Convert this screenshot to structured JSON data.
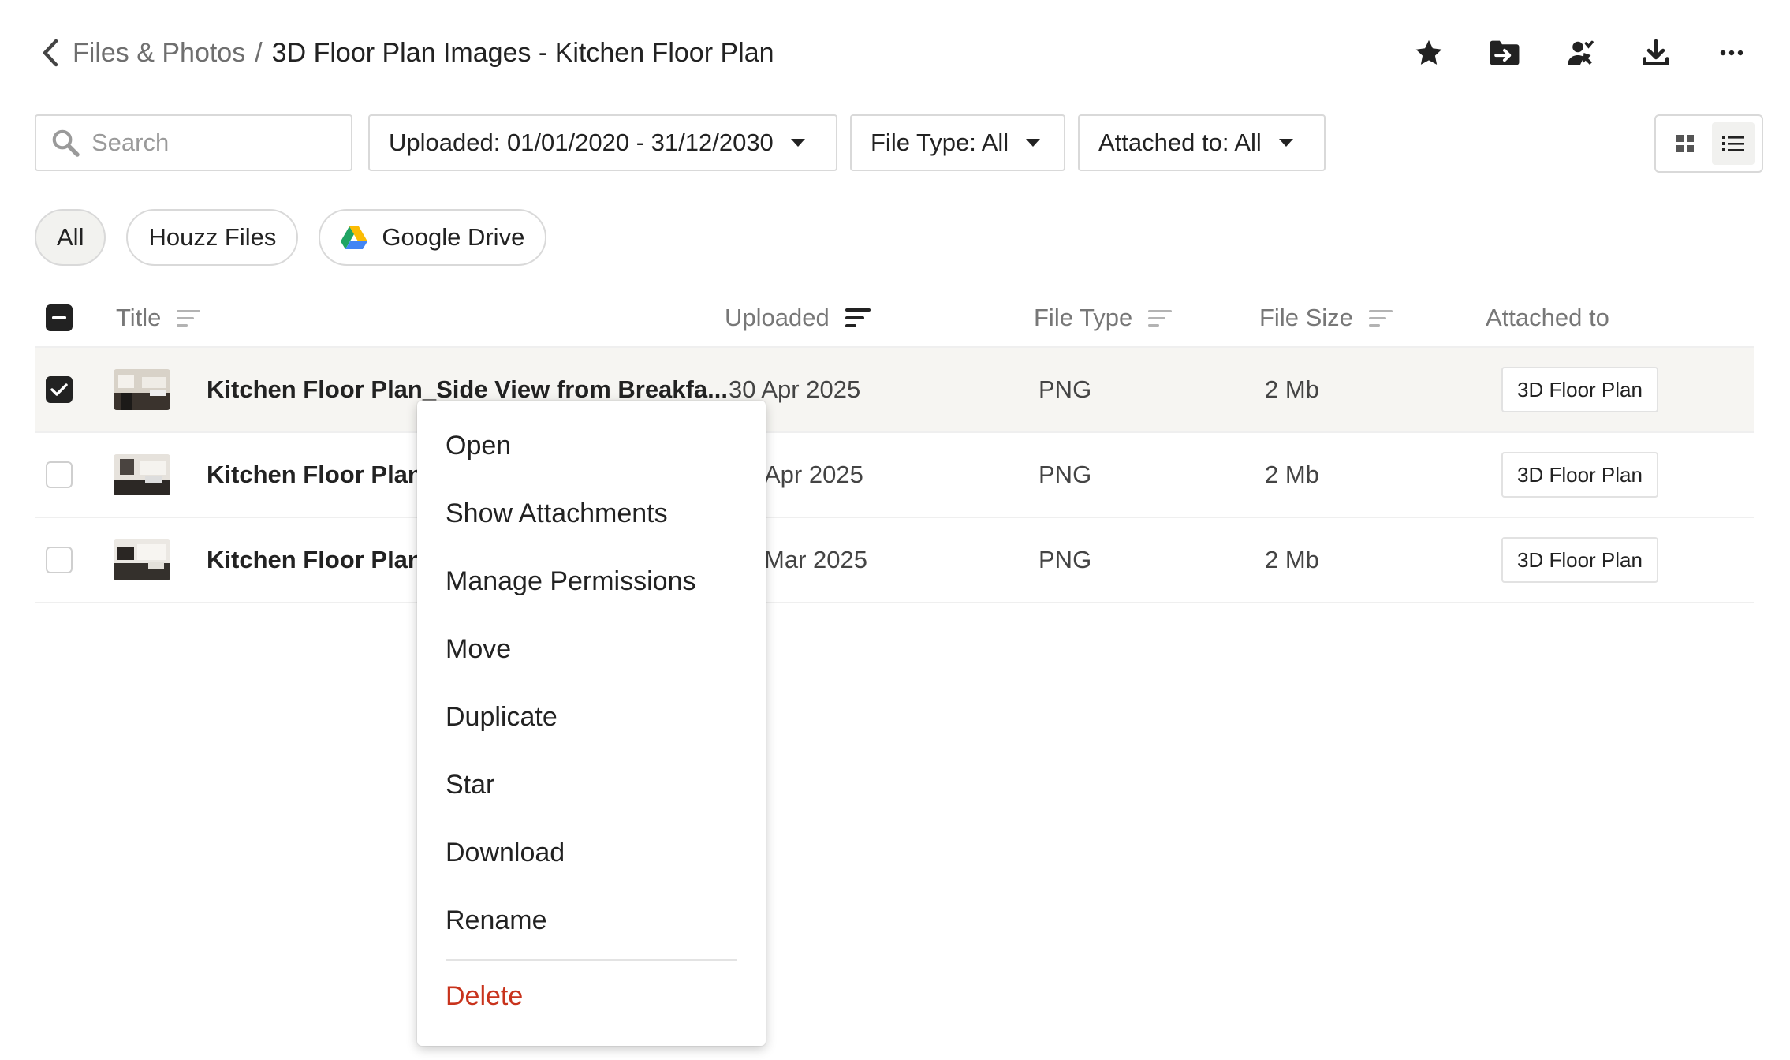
{
  "header": {
    "breadcrumb_parent": "Files & Photos",
    "breadcrumb_separator": "/",
    "breadcrumb_current": "3D Floor Plan Images - Kitchen Floor Plan",
    "actions": [
      {
        "icon": "star-icon"
      },
      {
        "icon": "move-icon"
      },
      {
        "icon": "manage-permissions-icon"
      },
      {
        "icon": "download-icon"
      },
      {
        "icon": "more-icon"
      }
    ]
  },
  "filters": {
    "search_placeholder": "Search",
    "uploaded": "Uploaded: 01/01/2020 - 31/12/2030",
    "file_type": "File Type: All",
    "attached_to": "Attached to: All"
  },
  "sources": {
    "all": "All",
    "houzz": "Houzz Files",
    "google_drive": "Google Drive"
  },
  "table": {
    "columns": {
      "title": "Title",
      "uploaded": "Uploaded",
      "file_type": "File Type",
      "file_size": "File Size",
      "attached_to": "Attached to"
    },
    "rows": [
      {
        "title": "Kitchen Floor Plan_Side View from Breakfa...",
        "uploaded": "30 Apr 2025",
        "type": "PNG",
        "size": "2 Mb",
        "attached": "3D Floor Plan",
        "checked": true
      },
      {
        "title": "Kitchen Floor Plan_",
        "uploaded": "Apr 2025",
        "type": "PNG",
        "size": "2 Mb",
        "attached": "3D Floor Plan",
        "checked": false
      },
      {
        "title": "Kitchen Floor Plan_(",
        "uploaded": "Mar 2025",
        "type": "PNG",
        "size": "2 Mb",
        "attached": "3D Floor Plan",
        "checked": false
      }
    ]
  },
  "context_menu": {
    "items": [
      "Open",
      "Show Attachments",
      "Manage Permissions",
      "Move",
      "Duplicate",
      "Star",
      "Download",
      "Rename"
    ],
    "delete": "Delete"
  },
  "colors": {
    "danger": "#c8331c",
    "selected_row": "#f6f5f2",
    "text": "#222222",
    "muted": "#777777"
  }
}
